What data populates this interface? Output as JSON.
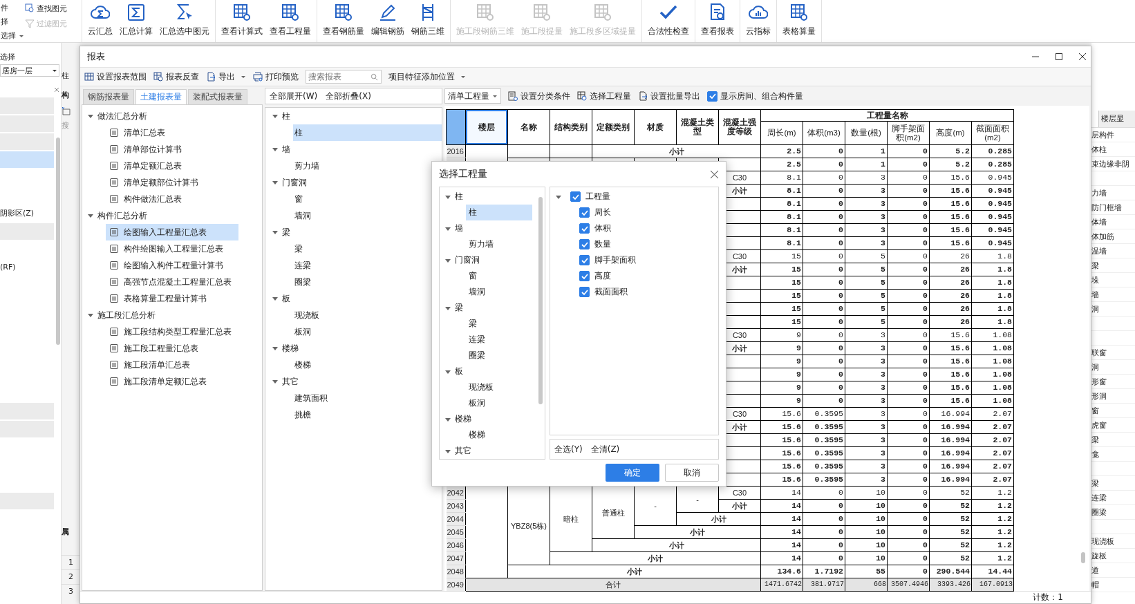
{
  "ribbon": {
    "side_labels": [
      "件",
      "择"
    ],
    "side_dropdown": "选择",
    "tools": [
      {
        "label": "查找图元",
        "disabled": false
      },
      {
        "label": "过滤图元",
        "disabled": true
      }
    ],
    "groups": [
      [
        {
          "label": "云汇总",
          "disabled": false
        },
        {
          "label": "汇总计算",
          "disabled": false
        },
        {
          "label": "汇总选中图元",
          "disabled": false
        }
      ],
      [
        {
          "label": "查看计算式",
          "disabled": false
        },
        {
          "label": "查看工程量",
          "disabled": false
        }
      ],
      [
        {
          "label": "查看钢筋量",
          "disabled": false
        },
        {
          "label": "编辑钢筋",
          "disabled": false
        },
        {
          "label": "钢筋三维",
          "disabled": false
        }
      ],
      [
        {
          "label": "施工段钢筋三维",
          "disabled": true
        },
        {
          "label": "施工段提量",
          "disabled": true
        },
        {
          "label": "施工段多区域提量",
          "disabled": true
        }
      ],
      [
        {
          "label": "合法性检查",
          "disabled": false
        }
      ],
      [
        {
          "label": "查看报表",
          "disabled": false
        }
      ],
      [
        {
          "label": "云指标",
          "disabled": false
        }
      ],
      [
        {
          "label": "表格算量",
          "disabled": false
        }
      ]
    ]
  },
  "left_panel": {
    "title": "选择",
    "floor": "居房一层",
    "rows": [
      {
        "kind": "bar",
        "selected": false
      },
      {
        "kind": "bar",
        "selected": false
      },
      {
        "kind": "bar",
        "selected": false
      },
      {
        "kind": "bar",
        "selected": true
      },
      {
        "kind": "empty"
      },
      {
        "kind": "empty"
      },
      {
        "kind": "text",
        "label": "阴影区(Z)",
        "selected": false
      },
      {
        "kind": "bar",
        "selected": false
      },
      {
        "kind": "empty"
      },
      {
        "kind": "text",
        "label": "(RF)",
        "selected": false
      },
      {
        "kind": "empty"
      },
      {
        "kind": "empty"
      },
      {
        "kind": "empty"
      },
      {
        "kind": "empty"
      },
      {
        "kind": "empty"
      },
      {
        "kind": "empty"
      },
      {
        "kind": "empty"
      },
      {
        "kind": "bar",
        "selected": false
      },
      {
        "kind": "bar",
        "selected": false
      },
      {
        "kind": "empty"
      },
      {
        "kind": "empty"
      },
      {
        "kind": "empty"
      },
      {
        "kind": "bar",
        "selected": false
      }
    ]
  },
  "side_strip": {
    "label": "柱",
    "tab": "构",
    "search": "搜",
    "header": "属",
    "row_numbers": [
      "1",
      "2",
      "3"
    ]
  },
  "right_panel": {
    "tab": "楼层显",
    "items": [
      {
        "kind": "text",
        "label": "层构件"
      },
      {
        "kind": "text",
        "label": "体柱"
      },
      {
        "kind": "text",
        "label": "束边缘非阴"
      },
      {
        "kind": "empty"
      },
      {
        "kind": "text",
        "label": "力墙"
      },
      {
        "kind": "text",
        "label": "防门框墙"
      },
      {
        "kind": "text",
        "label": "体墙"
      },
      {
        "kind": "text",
        "label": "体加筋"
      },
      {
        "kind": "text",
        "label": "温墙"
      },
      {
        "kind": "text",
        "label": "梁"
      },
      {
        "kind": "text",
        "label": "垛"
      },
      {
        "kind": "text",
        "label": "墙"
      },
      {
        "kind": "text",
        "label": "洞"
      },
      {
        "kind": "empty"
      },
      {
        "kind": "empty"
      },
      {
        "kind": "text",
        "label": "联窗"
      },
      {
        "kind": "text",
        "label": "洞"
      },
      {
        "kind": "text",
        "label": "形窗"
      },
      {
        "kind": "text",
        "label": "形洞"
      },
      {
        "kind": "text",
        "label": "窗"
      },
      {
        "kind": "text",
        "label": "虎窗"
      },
      {
        "kind": "text",
        "label": "梁"
      },
      {
        "kind": "text",
        "label": "龛"
      },
      {
        "kind": "empty"
      },
      {
        "kind": "text",
        "label": "梁"
      },
      {
        "kind": "text",
        "label": "连梁"
      },
      {
        "kind": "text",
        "label": "圈梁"
      },
      {
        "kind": "empty"
      },
      {
        "kind": "text",
        "label": "现浇板"
      },
      {
        "kind": "text",
        "label": "旋板"
      },
      {
        "kind": "text",
        "label": "道"
      },
      {
        "kind": "text",
        "label": "帽"
      }
    ]
  },
  "report_window": {
    "title": "报表",
    "toolbar": {
      "buttons": [
        {
          "label": "设置报表范围",
          "dropdown": false
        },
        {
          "label": "报表反查",
          "dropdown": false
        },
        {
          "label": "导出",
          "dropdown": true
        },
        {
          "label": "打印预览",
          "dropdown": false
        }
      ],
      "search": {
        "placeholder": "搜索报表"
      },
      "position_menu": "项目特征添加位置"
    },
    "tabs": [
      {
        "label": "钢筋报表量",
        "selected": false
      },
      {
        "label": "土建报表量",
        "selected": true
      },
      {
        "label": "装配式报表量",
        "selected": false
      }
    ],
    "report_tree": [
      {
        "label": "做法汇总分析",
        "expanded": true,
        "children": [
          {
            "label": "清单汇总表",
            "selected": false
          },
          {
            "label": "清单部位计算书",
            "selected": false
          },
          {
            "label": "清单定额汇总表",
            "selected": false
          },
          {
            "label": "清单定额部位计算书",
            "selected": false
          },
          {
            "label": "构件做法汇总表",
            "selected": false
          }
        ]
      },
      {
        "label": "构件汇总分析",
        "expanded": true,
        "children": [
          {
            "label": "绘图输入工程量汇总表",
            "selected": true
          },
          {
            "label": "构件绘图输入工程量汇总表",
            "selected": false
          },
          {
            "label": "绘图输入构件工程量计算书",
            "selected": false
          },
          {
            "label": "高强节点混凝土工程量汇总表",
            "selected": false
          },
          {
            "label": "表格算量工程量计算书",
            "selected": false
          }
        ]
      },
      {
        "label": "施工段汇总分析",
        "expanded": true,
        "children": [
          {
            "label": "施工段结构类型工程量汇总表",
            "selected": false
          },
          {
            "label": "施工段工程量汇总表",
            "selected": false
          },
          {
            "label": "施工段清单汇总表",
            "selected": false
          },
          {
            "label": "施工段清单定额汇总表",
            "selected": false
          }
        ]
      }
    ],
    "expand_all": "全部展开(W)",
    "collapse_all": "全部折叠(X)",
    "type_tree": [
      {
        "label": "柱",
        "expanded": true,
        "children": [
          {
            "label": "柱",
            "selected": true
          }
        ]
      },
      {
        "label": "墙",
        "expanded": true,
        "children": [
          {
            "label": "剪力墙",
            "selected": false
          }
        ]
      },
      {
        "label": "门窗洞",
        "expanded": true,
        "children": [
          {
            "label": "窗",
            "selected": false
          },
          {
            "label": "墙洞",
            "selected": false
          }
        ]
      },
      {
        "label": "梁",
        "expanded": true,
        "children": [
          {
            "label": "梁",
            "selected": false
          },
          {
            "label": "连梁",
            "selected": false
          },
          {
            "label": "圈梁",
            "selected": false
          }
        ]
      },
      {
        "label": "板",
        "expanded": true,
        "children": [
          {
            "label": "现浇板",
            "selected": false
          },
          {
            "label": "板洞",
            "selected": false
          }
        ]
      },
      {
        "label": "楼梯",
        "expanded": true,
        "children": [
          {
            "label": "楼梯",
            "selected": false
          }
        ]
      },
      {
        "label": "其它",
        "expanded": true,
        "children": [
          {
            "label": "建筑面积",
            "selected": false
          },
          {
            "label": "挑檐",
            "selected": false
          }
        ]
      }
    ],
    "table_toolbar": {
      "mode": "清单工程量",
      "classify": "设置分类条件",
      "select": "选择工程量",
      "batch_export": "设置批量导出",
      "show_rooms": {
        "label": "显示房间、组合构件量",
        "checked": true
      }
    },
    "table": {
      "columns": [
        {
          "label": "楼层",
          "selected": true
        },
        {
          "label": "名称",
          "selected": false
        },
        {
          "label": "结构类别",
          "selected": false
        },
        {
          "label": "定额类别",
          "selected": false
        },
        {
          "label": "材质",
          "selected": false
        },
        {
          "label": "混凝土类型",
          "selected": false
        },
        {
          "label": "混凝土强度等级",
          "selected": false
        }
      ],
      "group_heading": "工程量名称",
      "quantity_columns": [
        "周长(m)",
        "体积(m3)",
        "数量(根)",
        "脚手架面积(m2)",
        "高度(m)",
        "截面面积(m2)"
      ],
      "rows": [
        {
          "number": "2016",
          "cells": [
            "小计"
          ],
          "values": [
            "2.5",
            "0",
            "1",
            "0",
            "5.2",
            "0.285"
          ],
          "bold": true
        },
        {
          "values": [
            "2.5",
            "0",
            "1",
            "0",
            "5.2",
            "0.285"
          ],
          "bold": true
        },
        {
          "cells": [
            "C30"
          ],
          "values": [
            "8.1",
            "0",
            "3",
            "0",
            "15.6",
            "0.945"
          ],
          "bold": false
        },
        {
          "cells": [
            "小计"
          ],
          "values": [
            "8.1",
            "0",
            "3",
            "0",
            "15.6",
            "0.945"
          ],
          "bold": true
        },
        {
          "values": [
            "8.1",
            "0",
            "3",
            "0",
            "15.6",
            "0.945"
          ],
          "bold": true
        },
        {
          "values": [
            "8.1",
            "0",
            "3",
            "0",
            "15.6",
            "0.945"
          ],
          "bold": true
        },
        {
          "values": [
            "8.1",
            "0",
            "3",
            "0",
            "15.6",
            "0.945"
          ],
          "bold": true
        },
        {
          "values": [
            "8.1",
            "0",
            "3",
            "0",
            "15.6",
            "0.945"
          ],
          "bold": true
        },
        {
          "cells": [
            "C30"
          ],
          "values": [
            "15",
            "0",
            "5",
            "0",
            "26",
            "1.8"
          ],
          "bold": false
        },
        {
          "cells": [
            "小计"
          ],
          "values": [
            "15",
            "0",
            "5",
            "0",
            "26",
            "1.8"
          ],
          "bold": true
        },
        {
          "values": [
            "15",
            "0",
            "5",
            "0",
            "26",
            "1.8"
          ],
          "bold": true
        },
        {
          "values": [
            "15",
            "0",
            "5",
            "0",
            "26",
            "1.8"
          ],
          "bold": true
        },
        {
          "values": [
            "15",
            "0",
            "5",
            "0",
            "26",
            "1.8"
          ],
          "bold": true
        },
        {
          "values": [
            "15",
            "0",
            "5",
            "0",
            "26",
            "1.8"
          ],
          "bold": true
        },
        {
          "cells": [
            "C30"
          ],
          "values": [
            "9",
            "0",
            "3",
            "0",
            "15.6",
            "1.08"
          ],
          "bold": false
        },
        {
          "cells": [
            "小计"
          ],
          "values": [
            "9",
            "0",
            "3",
            "0",
            "15.6",
            "1.08"
          ],
          "bold": true
        },
        {
          "values": [
            "9",
            "0",
            "3",
            "0",
            "15.6",
            "1.08"
          ],
          "bold": true
        },
        {
          "values": [
            "9",
            "0",
            "3",
            "0",
            "15.6",
            "1.08"
          ],
          "bold": true
        },
        {
          "values": [
            "9",
            "0",
            "3",
            "0",
            "15.6",
            "1.08"
          ],
          "bold": true
        },
        {
          "values": [
            "9",
            "0",
            "3",
            "0",
            "15.6",
            "1.08"
          ],
          "bold": true
        },
        {
          "cells": [
            "C30"
          ],
          "values": [
            "15.6",
            "0.3595",
            "3",
            "0",
            "16.994",
            "2.07"
          ],
          "bold": false
        },
        {
          "cells": [
            "小计"
          ],
          "values": [
            "15.6",
            "0.3595",
            "3",
            "0",
            "16.994",
            "2.07"
          ],
          "bold": true
        },
        {
          "values": [
            "15.6",
            "0.3595",
            "3",
            "0",
            "16.994",
            "2.07"
          ],
          "bold": true
        },
        {
          "values": [
            "15.6",
            "0.3595",
            "3",
            "0",
            "16.994",
            "2.07"
          ],
          "bold": true
        },
        {
          "values": [
            "15.6",
            "0.3595",
            "3",
            "0",
            "16.994",
            "2.07"
          ],
          "bold": true
        },
        {
          "values": [
            "15.6",
            "0.3595",
            "3",
            "0",
            "16.994",
            "2.07"
          ],
          "bold": true
        },
        {
          "number": "2042",
          "cells": [
            "YBZ8(5栋)",
            "暗柱",
            "普通柱",
            "-",
            "-",
            "C30"
          ],
          "values": [
            "14",
            "0",
            "10",
            "0",
            "52",
            "1.2"
          ],
          "bold": false
        },
        {
          "number": "2043",
          "cells": [
            "小计"
          ],
          "values": [
            "14",
            "0",
            "10",
            "0",
            "52",
            "1.2"
          ],
          "bold": true
        },
        {
          "number": "2044",
          "cells": [
            "小计"
          ],
          "values": [
            "14",
            "0",
            "10",
            "0",
            "52",
            "1.2"
          ],
          "bold": true
        },
        {
          "number": "2045",
          "cells": [
            "小计"
          ],
          "values": [
            "14",
            "0",
            "10",
            "0",
            "52",
            "1.2"
          ],
          "bold": true
        },
        {
          "number": "2046",
          "cells": [
            "小计"
          ],
          "values": [
            "14",
            "0",
            "10",
            "0",
            "52",
            "1.2"
          ],
          "bold": true
        },
        {
          "number": "2047",
          "cells": [
            "小计"
          ],
          "values": [
            "14",
            "0",
            "10",
            "0",
            "52",
            "1.2"
          ],
          "bold": true
        },
        {
          "number": "2048",
          "cells": [
            "小计"
          ],
          "values": [
            "134.6",
            "1.7192",
            "55",
            "0",
            "290.544",
            "14.44"
          ],
          "bold": true
        },
        {
          "number": "2049",
          "kind": "total",
          "cells": [
            "合计"
          ],
          "values": [
            "1471.6742",
            "381.9717",
            "668",
            "3507.4946",
            "3393.426",
            "167.0913"
          ],
          "bold": false
        }
      ]
    },
    "status": "计数：1"
  },
  "dialog": {
    "title": "选择工程量",
    "tree": [
      {
        "label": "柱",
        "expanded": true,
        "children": [
          {
            "label": "柱",
            "selected": true
          }
        ]
      },
      {
        "label": "墙",
        "expanded": true,
        "children": [
          {
            "label": "剪力墙",
            "selected": false
          }
        ]
      },
      {
        "label": "门窗洞",
        "expanded": true,
        "children": [
          {
            "label": "窗",
            "selected": false
          },
          {
            "label": "墙洞",
            "selected": false
          }
        ]
      },
      {
        "label": "梁",
        "expanded": true,
        "children": [
          {
            "label": "梁",
            "selected": false
          },
          {
            "label": "连梁",
            "selected": false
          },
          {
            "label": "圈梁",
            "selected": false
          }
        ]
      },
      {
        "label": "板",
        "expanded": true,
        "children": [
          {
            "label": "现浇板",
            "selected": false
          },
          {
            "label": "板洞",
            "selected": false
          }
        ]
      },
      {
        "label": "楼梯",
        "expanded": true,
        "children": [
          {
            "label": "楼梯",
            "selected": false
          }
        ]
      },
      {
        "label": "其它",
        "expanded": true
      }
    ],
    "quantities": {
      "label": "工程量",
      "checked": true,
      "expanded": true,
      "children": [
        {
          "label": "周长",
          "checked": true
        },
        {
          "label": "体积",
          "checked": true
        },
        {
          "label": "数量",
          "checked": true
        },
        {
          "label": "脚手架面积",
          "checked": true
        },
        {
          "label": "高度",
          "checked": true
        },
        {
          "label": "截面面积",
          "checked": true
        }
      ]
    },
    "select_all": "全选(Y)",
    "clear_all": "全清(Z)",
    "buttons": [
      {
        "label": "确定",
        "kind": "primary"
      },
      {
        "label": "取消",
        "kind": "secondary"
      }
    ]
  }
}
